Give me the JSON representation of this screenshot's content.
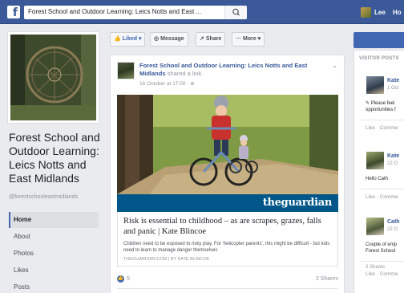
{
  "topbar": {
    "logo": "f",
    "search_value": "Forest School and Outdoor Learning: Leics Notts and East ...",
    "search_icon": "search-icon",
    "user_name": "Lee",
    "home_label": "Ho"
  },
  "sidebar": {
    "page_name": "Forest School and Outdoor Learning: Leics Notts and East Midlands",
    "page_handle": "@forestschooleastmidlands",
    "items": [
      {
        "label": "Home"
      },
      {
        "label": "About"
      },
      {
        "label": "Photos"
      },
      {
        "label": "Likes"
      },
      {
        "label": "Posts"
      }
    ]
  },
  "actions": {
    "liked": "Liked",
    "message": "Message",
    "share": "Share",
    "more": "More"
  },
  "post": {
    "author": "Forest School and Outdoor Learning: Leics Notts and East Midlands",
    "action_text": "shared a link.",
    "time": "16 October at 17:00 · ⊕",
    "source_logo": "theguardian",
    "link_title": "Risk is essential to childhood – as are scrapes, grazes, falls and panic | Kate Blincoe",
    "link_desc": "Children need to be exposed to risky play. For 'helicopter parents', this might be difficult - but kids need to learn to manage danger themselves",
    "link_source": "THEGUARDIAN.COM | BY KATE BLINCOE",
    "like_count": "5",
    "shares": "2 Shares"
  },
  "visitor_posts": {
    "header": "VISITOR POSTS",
    "items": [
      {
        "name": "Kate",
        "date": "1 Oct",
        "text1": "✎ Please feel",
        "text2": "opportunities f",
        "actions": "Like · Comme"
      },
      {
        "name": "Kate",
        "date": "22 O",
        "text1": "Hello Cath",
        "text2": "",
        "actions": "Like · Comme"
      },
      {
        "name": "Cath",
        "date": "22 O",
        "text1": "Couple of emp",
        "text2": "Forest School",
        "shares": "2 Shares",
        "actions": "Like · Comme"
      }
    ]
  },
  "colors": {
    "fb_blue": "#3b5998",
    "link_blue": "#365899",
    "guardian_blue": "#005689",
    "background": "#e9ebee"
  }
}
